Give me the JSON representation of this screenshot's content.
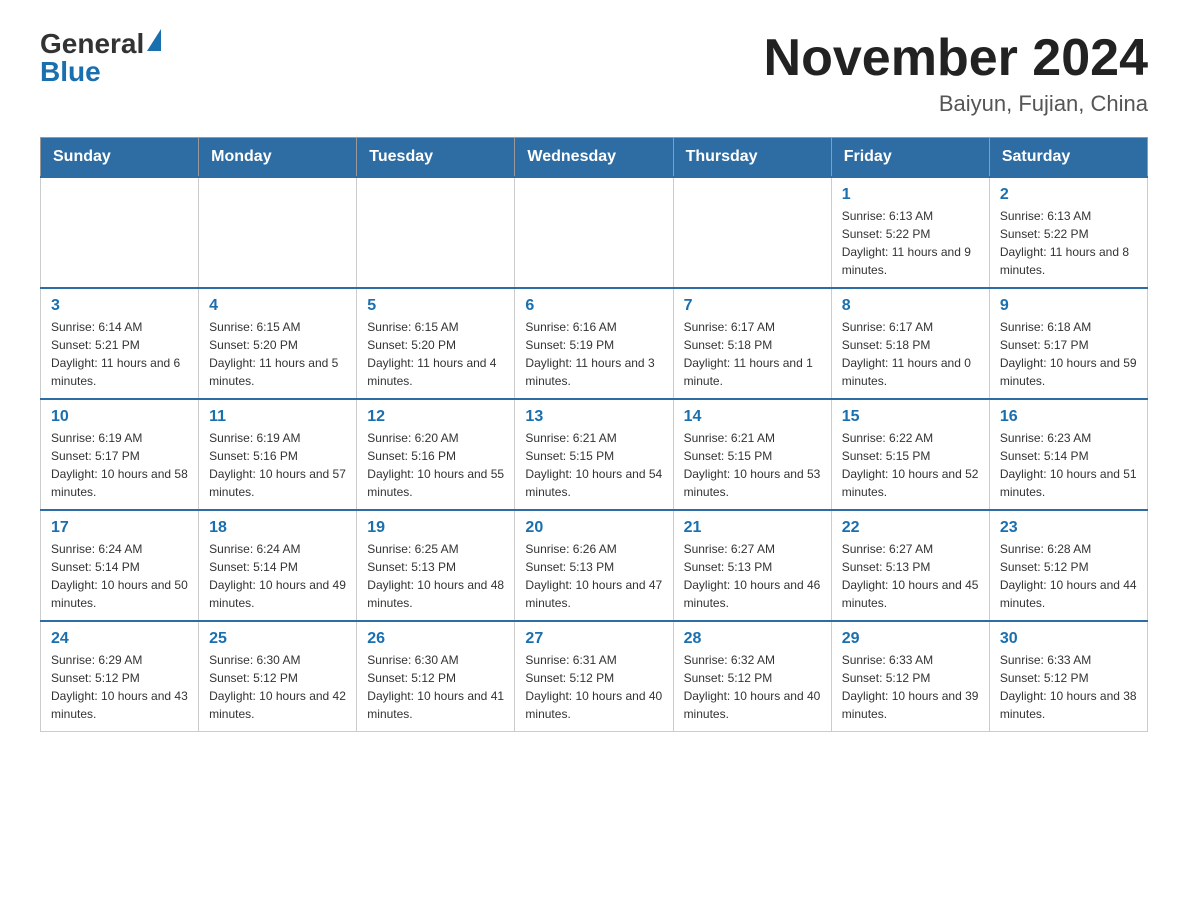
{
  "header": {
    "logo_general": "General",
    "logo_blue": "Blue",
    "month_year": "November 2024",
    "location": "Baiyun, Fujian, China"
  },
  "weekdays": [
    "Sunday",
    "Monday",
    "Tuesday",
    "Wednesday",
    "Thursday",
    "Friday",
    "Saturday"
  ],
  "weeks": [
    [
      {
        "day": "",
        "info": ""
      },
      {
        "day": "",
        "info": ""
      },
      {
        "day": "",
        "info": ""
      },
      {
        "day": "",
        "info": ""
      },
      {
        "day": "",
        "info": ""
      },
      {
        "day": "1",
        "info": "Sunrise: 6:13 AM\nSunset: 5:22 PM\nDaylight: 11 hours and 9 minutes."
      },
      {
        "day": "2",
        "info": "Sunrise: 6:13 AM\nSunset: 5:22 PM\nDaylight: 11 hours and 8 minutes."
      }
    ],
    [
      {
        "day": "3",
        "info": "Sunrise: 6:14 AM\nSunset: 5:21 PM\nDaylight: 11 hours and 6 minutes."
      },
      {
        "day": "4",
        "info": "Sunrise: 6:15 AM\nSunset: 5:20 PM\nDaylight: 11 hours and 5 minutes."
      },
      {
        "day": "5",
        "info": "Sunrise: 6:15 AM\nSunset: 5:20 PM\nDaylight: 11 hours and 4 minutes."
      },
      {
        "day": "6",
        "info": "Sunrise: 6:16 AM\nSunset: 5:19 PM\nDaylight: 11 hours and 3 minutes."
      },
      {
        "day": "7",
        "info": "Sunrise: 6:17 AM\nSunset: 5:18 PM\nDaylight: 11 hours and 1 minute."
      },
      {
        "day": "8",
        "info": "Sunrise: 6:17 AM\nSunset: 5:18 PM\nDaylight: 11 hours and 0 minutes."
      },
      {
        "day": "9",
        "info": "Sunrise: 6:18 AM\nSunset: 5:17 PM\nDaylight: 10 hours and 59 minutes."
      }
    ],
    [
      {
        "day": "10",
        "info": "Sunrise: 6:19 AM\nSunset: 5:17 PM\nDaylight: 10 hours and 58 minutes."
      },
      {
        "day": "11",
        "info": "Sunrise: 6:19 AM\nSunset: 5:16 PM\nDaylight: 10 hours and 57 minutes."
      },
      {
        "day": "12",
        "info": "Sunrise: 6:20 AM\nSunset: 5:16 PM\nDaylight: 10 hours and 55 minutes."
      },
      {
        "day": "13",
        "info": "Sunrise: 6:21 AM\nSunset: 5:15 PM\nDaylight: 10 hours and 54 minutes."
      },
      {
        "day": "14",
        "info": "Sunrise: 6:21 AM\nSunset: 5:15 PM\nDaylight: 10 hours and 53 minutes."
      },
      {
        "day": "15",
        "info": "Sunrise: 6:22 AM\nSunset: 5:15 PM\nDaylight: 10 hours and 52 minutes."
      },
      {
        "day": "16",
        "info": "Sunrise: 6:23 AM\nSunset: 5:14 PM\nDaylight: 10 hours and 51 minutes."
      }
    ],
    [
      {
        "day": "17",
        "info": "Sunrise: 6:24 AM\nSunset: 5:14 PM\nDaylight: 10 hours and 50 minutes."
      },
      {
        "day": "18",
        "info": "Sunrise: 6:24 AM\nSunset: 5:14 PM\nDaylight: 10 hours and 49 minutes."
      },
      {
        "day": "19",
        "info": "Sunrise: 6:25 AM\nSunset: 5:13 PM\nDaylight: 10 hours and 48 minutes."
      },
      {
        "day": "20",
        "info": "Sunrise: 6:26 AM\nSunset: 5:13 PM\nDaylight: 10 hours and 47 minutes."
      },
      {
        "day": "21",
        "info": "Sunrise: 6:27 AM\nSunset: 5:13 PM\nDaylight: 10 hours and 46 minutes."
      },
      {
        "day": "22",
        "info": "Sunrise: 6:27 AM\nSunset: 5:13 PM\nDaylight: 10 hours and 45 minutes."
      },
      {
        "day": "23",
        "info": "Sunrise: 6:28 AM\nSunset: 5:12 PM\nDaylight: 10 hours and 44 minutes."
      }
    ],
    [
      {
        "day": "24",
        "info": "Sunrise: 6:29 AM\nSunset: 5:12 PM\nDaylight: 10 hours and 43 minutes."
      },
      {
        "day": "25",
        "info": "Sunrise: 6:30 AM\nSunset: 5:12 PM\nDaylight: 10 hours and 42 minutes."
      },
      {
        "day": "26",
        "info": "Sunrise: 6:30 AM\nSunset: 5:12 PM\nDaylight: 10 hours and 41 minutes."
      },
      {
        "day": "27",
        "info": "Sunrise: 6:31 AM\nSunset: 5:12 PM\nDaylight: 10 hours and 40 minutes."
      },
      {
        "day": "28",
        "info": "Sunrise: 6:32 AM\nSunset: 5:12 PM\nDaylight: 10 hours and 40 minutes."
      },
      {
        "day": "29",
        "info": "Sunrise: 6:33 AM\nSunset: 5:12 PM\nDaylight: 10 hours and 39 minutes."
      },
      {
        "day": "30",
        "info": "Sunrise: 6:33 AM\nSunset: 5:12 PM\nDaylight: 10 hours and 38 minutes."
      }
    ]
  ]
}
